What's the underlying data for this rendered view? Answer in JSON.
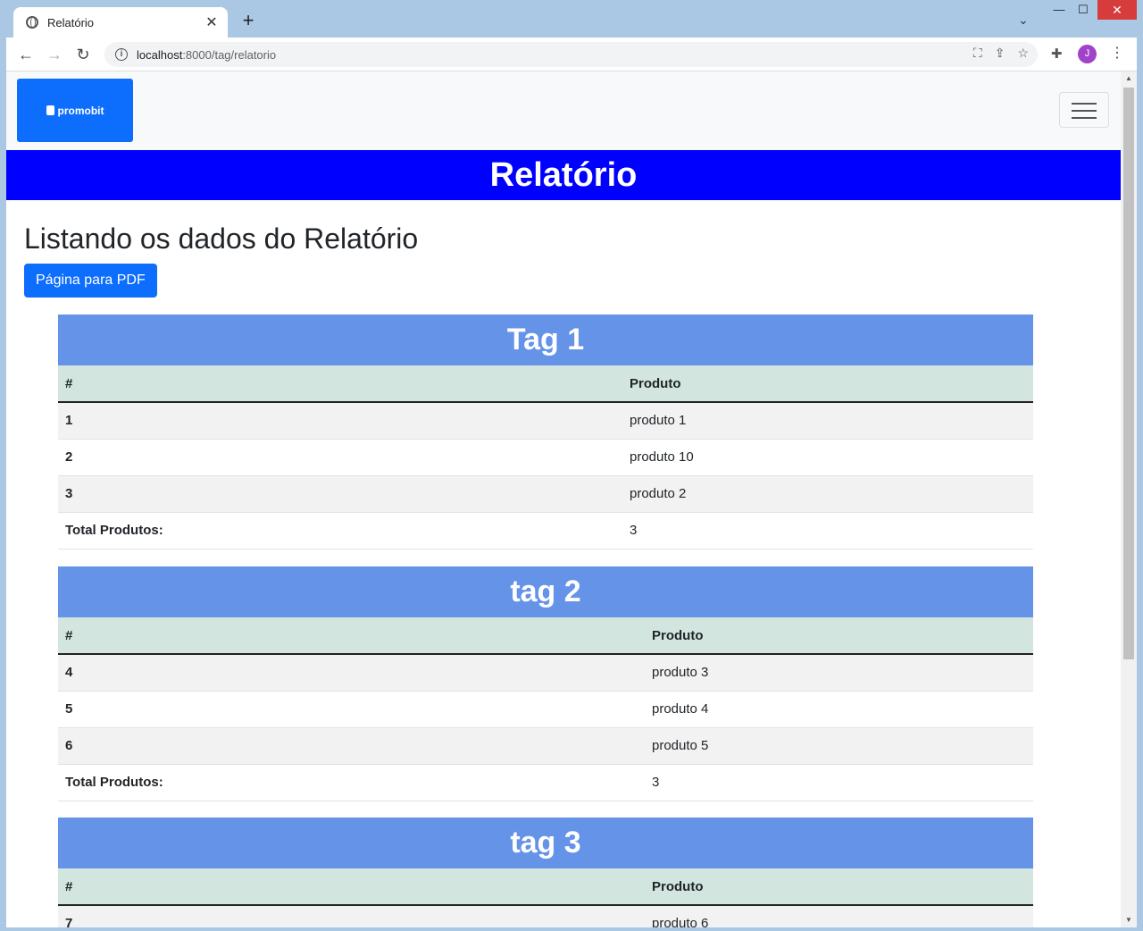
{
  "browser": {
    "tab_title": "Relatório",
    "tab_close": "✕",
    "new_tab": "+",
    "url_host": "localhost",
    "url_path": ":8000/tag/relatorio",
    "avatar_letter": "J"
  },
  "navbar": {
    "logo_text": "promobit"
  },
  "banner": {
    "title": "Relatório"
  },
  "main": {
    "heading": "Listando os dados do Relatório",
    "pdf_button": "Página para PDF"
  },
  "tags": [
    {
      "name": "Tag 1",
      "col_index": "#",
      "col_product": "Produto",
      "rows": [
        {
          "id": "1",
          "product": "produto 1"
        },
        {
          "id": "2",
          "product": "produto 10"
        },
        {
          "id": "3",
          "product": "produto 2"
        }
      ],
      "total_label": "Total Produtos:",
      "total_value": "3"
    },
    {
      "name": "tag 2",
      "col_index": "#",
      "col_product": "Produto",
      "rows": [
        {
          "id": "4",
          "product": "produto 3"
        },
        {
          "id": "5",
          "product": "produto 4"
        },
        {
          "id": "6",
          "product": "produto 5"
        }
      ],
      "total_label": "Total Produtos:",
      "total_value": "3"
    },
    {
      "name": "tag 3",
      "col_index": "#",
      "col_product": "Produto",
      "rows": [
        {
          "id": "7",
          "product": "produto 6"
        }
      ]
    }
  ],
  "colors": {
    "banner": "#0000ff",
    "tag_header": "#6593e8",
    "table_head": "#d2e6df",
    "primary_button": "#0d6efd"
  }
}
